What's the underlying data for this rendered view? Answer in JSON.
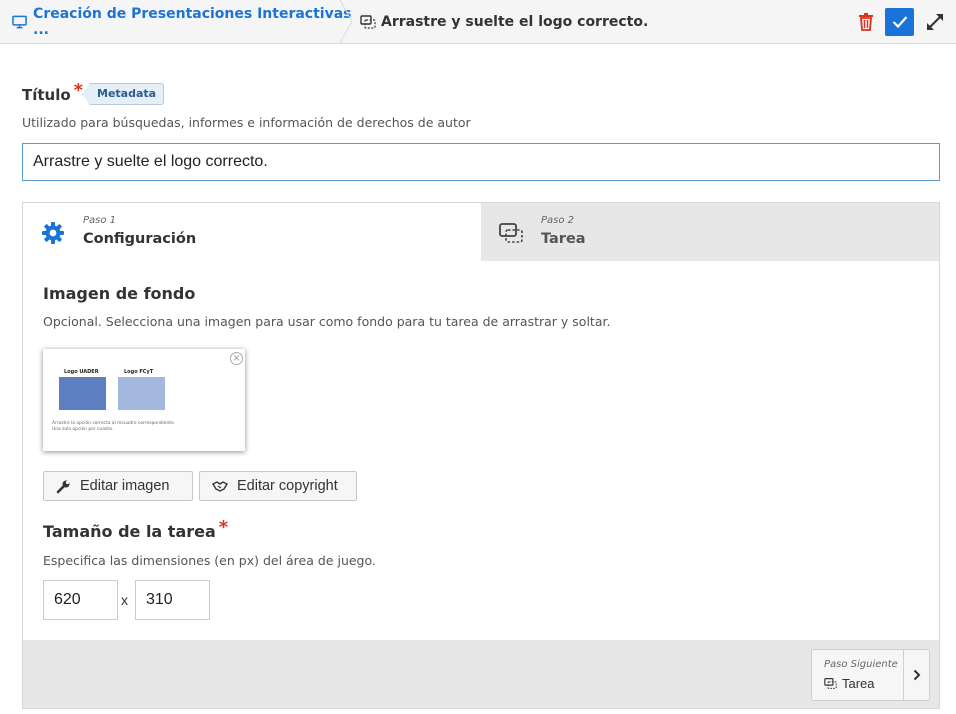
{
  "topbar": {
    "breadcrumb_parent": "Creación de Presentaciones Interactivas ...",
    "breadcrumb_current": "Arrastre y suelte el logo correcto.",
    "icons": {
      "parent": "presentation-icon",
      "current": "drag-drop-icon",
      "delete": "trash-icon",
      "confirm": "check-icon",
      "fullscreen": "expand-icon"
    },
    "colors": {
      "accent": "#1a73d9",
      "danger": "#e0301e"
    }
  },
  "title_field": {
    "label": "Título",
    "required_mark": "*",
    "badge": "Metadata",
    "description": "Utilizado para búsquedas, informes e información de derechos de autor",
    "value": "Arrastre y suelte el logo correcto."
  },
  "wizard": {
    "tabs": [
      {
        "step": "Paso 1",
        "label": "Configuración",
        "icon": "gear-icon",
        "active": true
      },
      {
        "step": "Paso 2",
        "label": "Tarea",
        "icon": "drag-drop-icon",
        "active": false
      }
    ],
    "background": {
      "title": "Imagen de fondo",
      "description": "Opcional. Selecciona una imagen para usar como fondo para tu tarea de arrastrar y soltar.",
      "thumbnail": {
        "label_left": "Logo UADER",
        "label_right": "Logo FCyT",
        "caption_line1": "Arrastre la opción correcta al recuadro correspondiente.",
        "caption_line2": "Una sola opción por cuadro."
      },
      "edit_image_label": "Editar imagen",
      "edit_copyright_label": "Editar copyright"
    },
    "size": {
      "title": "Tamaño de la tarea",
      "required_mark": "*",
      "description": "Especifica las dimensiones (en px) del área de juego.",
      "width": "620",
      "separator": "x",
      "height": "310"
    },
    "footer": {
      "next_step": "Paso Siguiente",
      "next_label": "Tarea"
    }
  }
}
